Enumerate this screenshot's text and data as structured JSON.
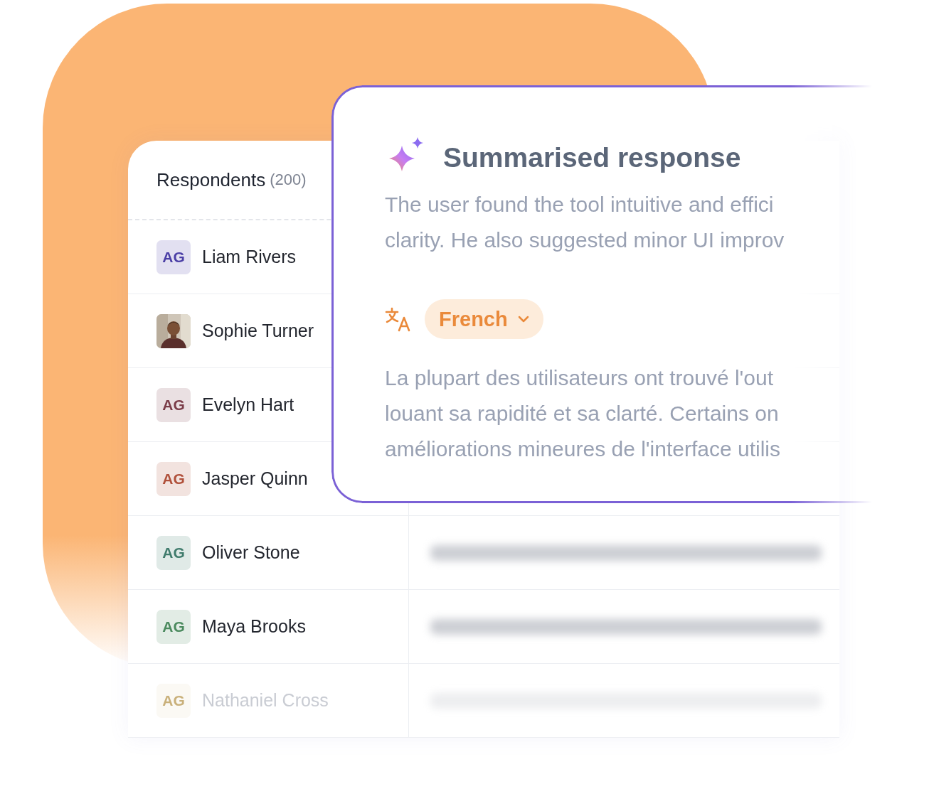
{
  "respondents": {
    "title": "Respondents",
    "count": "(200)",
    "items": [
      {
        "name": "Liam Rivers",
        "avatar": {
          "kind": "initials",
          "text": "AG",
          "color": "#4b3fa6"
        },
        "preview_visible": false
      },
      {
        "name": "Sophie Turner",
        "preview_visible": false
      },
      {
        "name": "Evelyn Hart",
        "avatar": {
          "kind": "initials",
          "text": "AG",
          "color": "#7a3c48"
        },
        "preview_visible": false
      },
      {
        "name": "Jasper Quinn",
        "avatar": {
          "kind": "initials",
          "text": "AG",
          "color": "#b0503a"
        },
        "preview_visible": false
      },
      {
        "name": "Oliver Stone",
        "avatar": {
          "kind": "initials",
          "text": "AG",
          "color": "#3f7b6c"
        },
        "preview_visible": true
      },
      {
        "name": "Maya Brooks",
        "avatar": {
          "kind": "initials",
          "text": "AG",
          "color": "#4b8a5e"
        },
        "preview_visible": true
      },
      {
        "name": "Nathaniel Cross",
        "avatar": {
          "kind": "initials",
          "text": "AG",
          "color": "#c9b07a"
        },
        "preview_visible": true,
        "faded": true
      }
    ]
  },
  "summary": {
    "title": "Summarised response",
    "lines": [
      "The user found the tool intuitive and effici",
      "clarity. He also suggested minor UI improv"
    ],
    "language": {
      "label": "French"
    },
    "translation_lines": [
      "La plupart des utilisateurs ont trouvé l'out",
      "louant sa rapidité et sa clarté. Certains on",
      "améliorations mineures de l'interface utilis"
    ]
  }
}
